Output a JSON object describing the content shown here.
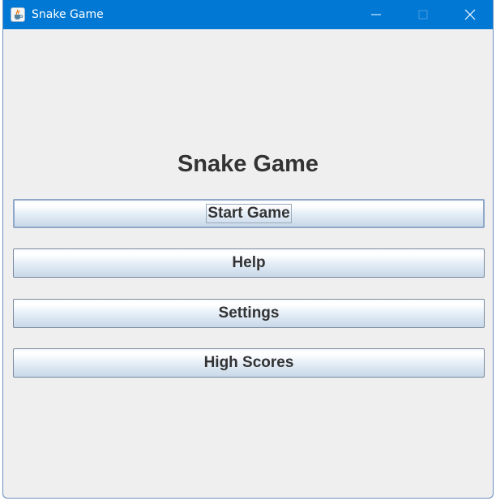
{
  "window": {
    "title": "Snake Game",
    "title_bar_color": "#0078d4",
    "icon": "java-cup-icon"
  },
  "window_controls": {
    "minimize_icon": "minimize-icon",
    "maximize_icon": "maximize-icon",
    "close_icon": "close-icon"
  },
  "main": {
    "heading": "Snake Game",
    "buttons": [
      {
        "label": "Start Game",
        "focused": true
      },
      {
        "label": "Help"
      },
      {
        "label": "Settings"
      },
      {
        "label": "High Scores"
      }
    ]
  }
}
